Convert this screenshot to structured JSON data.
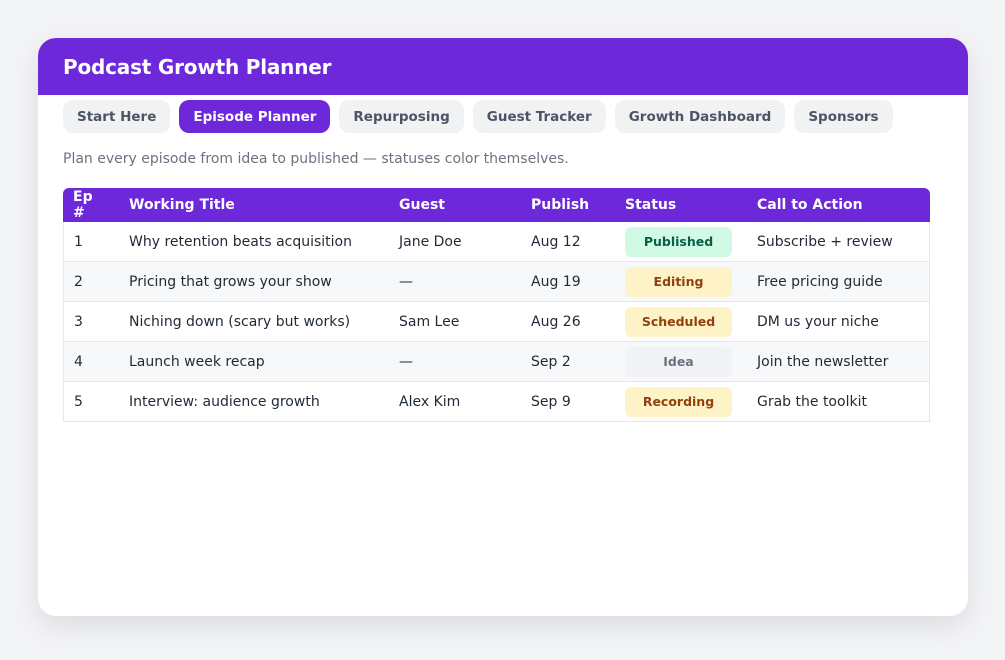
{
  "app": {
    "title": "Podcast Growth Planner"
  },
  "tabs": [
    {
      "label": "Start Here",
      "active": false
    },
    {
      "label": "Episode Planner",
      "active": true
    },
    {
      "label": "Repurposing",
      "active": false
    },
    {
      "label": "Guest Tracker",
      "active": false
    },
    {
      "label": "Growth Dashboard",
      "active": false
    },
    {
      "label": "Sponsors",
      "active": false
    }
  ],
  "subtitle": "Plan every episode from idea to published — statuses color themselves.",
  "table": {
    "headers": [
      "Ep #",
      "Working Title",
      "Guest",
      "Publish",
      "Status",
      "Call to Action"
    ],
    "rows": [
      {
        "ep": "1",
        "title": "Why retention beats acquisition",
        "guest": "Jane Doe",
        "publish": "Aug 12",
        "status": "Published",
        "cta": "Subscribe + review"
      },
      {
        "ep": "2",
        "title": "Pricing that grows your show",
        "guest": "—",
        "publish": "Aug 19",
        "status": "Editing",
        "cta": "Free pricing guide"
      },
      {
        "ep": "3",
        "title": "Niching down (scary but works)",
        "guest": "Sam Lee",
        "publish": "Aug 26",
        "status": "Scheduled",
        "cta": "DM us your niche"
      },
      {
        "ep": "4",
        "title": "Launch week recap",
        "guest": "—",
        "publish": "Sep 2",
        "status": "Idea",
        "cta": "Join the newsletter"
      },
      {
        "ep": "5",
        "title": "Interview: audience growth",
        "guest": "Alex Kim",
        "publish": "Sep 9",
        "status": "Recording",
        "cta": "Grab the toolkit"
      }
    ]
  },
  "status_colors": {
    "Published": {
      "bg": "#d1fae5",
      "fg": "#065f46"
    },
    "Editing": {
      "bg": "#fef3c7",
      "fg": "#92400e"
    },
    "Scheduled": {
      "bg": "#fef3c7",
      "fg": "#92400e"
    },
    "Idea": {
      "bg": "#f1f3f6",
      "fg": "#6b7280"
    },
    "Recording": {
      "bg": "#fef3c7",
      "fg": "#92400e"
    }
  },
  "colors": {
    "accent": "#6d28d9"
  }
}
